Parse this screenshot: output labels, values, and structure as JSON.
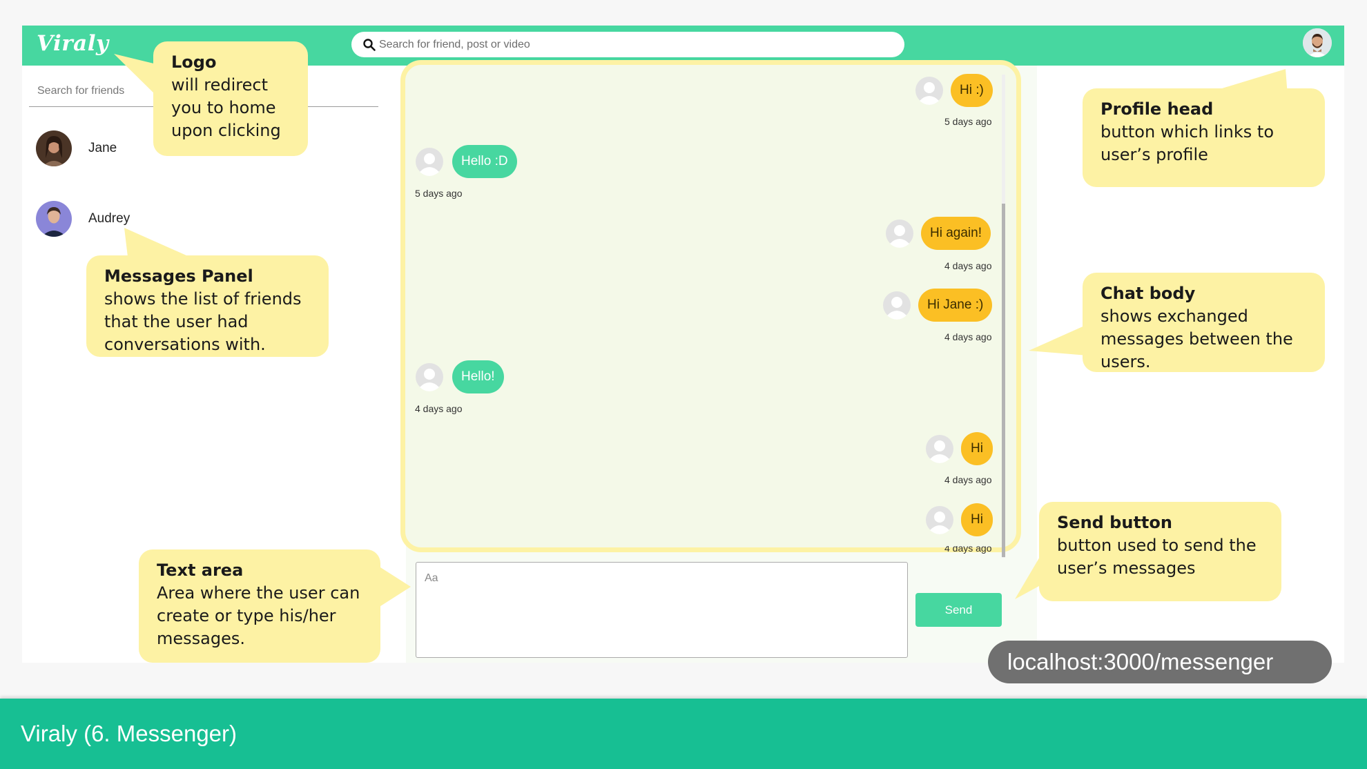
{
  "app": {
    "logo": "Viraly",
    "search_placeholder": "Search for friend, post or video"
  },
  "friends_panel": {
    "search_placeholder": "Search for friends",
    "friends": [
      {
        "name": "Jane"
      },
      {
        "name": "Audrey"
      }
    ]
  },
  "chat": {
    "messages": [
      {
        "text": "Hi :)",
        "time": "5 days ago",
        "from": "me"
      },
      {
        "text": "Hello :D",
        "time": "5 days ago",
        "from": "friend"
      },
      {
        "text": "Hi again!",
        "time": "4 days ago",
        "from": "me"
      },
      {
        "text": "Hi Jane :)",
        "time": "4 days ago",
        "from": "me"
      },
      {
        "text": "Hello!",
        "time": "4 days ago",
        "from": "friend"
      },
      {
        "text": "Hi",
        "time": "4 days ago",
        "from": "me"
      },
      {
        "text": "Hi",
        "time": "4 days ago",
        "from": "me"
      }
    ],
    "composer_placeholder": "Aa",
    "send_label": "Send"
  },
  "callouts": {
    "logo": {
      "title": "Logo",
      "body": "will redirect you to home upon clicking"
    },
    "messages_panel": {
      "title": "Messages Panel",
      "body": "shows the list of friends that the user had conversations with."
    },
    "profile_head": {
      "title": "Profile head",
      "body": "button which links to user’s profile"
    },
    "chat_body": {
      "title": "Chat body",
      "body": "shows exchanged messages between the users."
    },
    "send_button": {
      "title": "Send button",
      "body": "button used to send the user’s messages"
    },
    "text_area": {
      "title": "Text area",
      "body": "Area where the user can create or type  his/her messages."
    }
  },
  "url": "localhost:3000/messenger",
  "footer_title": "Viraly (6. Messenger)",
  "colors": {
    "brand": "#47d7a0",
    "footer": "#17bf93",
    "my_bubble": "#fbbf24",
    "callout": "#fdf2a4"
  }
}
